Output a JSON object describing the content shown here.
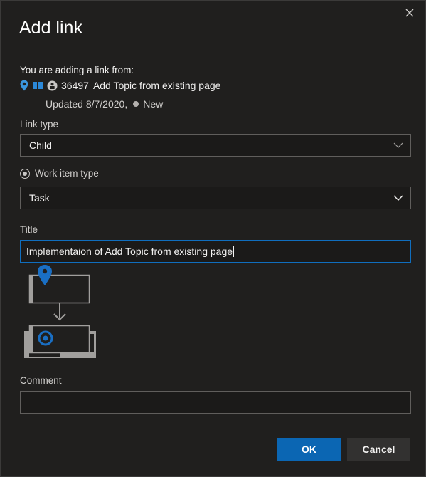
{
  "dialog": {
    "title": "Add link",
    "close_icon": "close-icon"
  },
  "source": {
    "label": "You are adding a link from:",
    "icons": [
      "location-pin-icon",
      "book-icon",
      "lock-person-icon"
    ],
    "id": "36497",
    "link_text": "Add Topic from existing page",
    "updated": "Updated 8/7/2020,",
    "state": "New"
  },
  "link_type": {
    "label": "Link type",
    "value": "Child"
  },
  "work_item_type": {
    "label": "Work item type",
    "value": "Task"
  },
  "title_field": {
    "label": "Title",
    "value": "Implementaion of Add Topic from existing page"
  },
  "comment_field": {
    "label": "Comment",
    "value": ""
  },
  "buttons": {
    "ok": "OK",
    "cancel": "Cancel"
  },
  "colors": {
    "accent": "#0b66b3",
    "background": "#201f1e",
    "focus_border": "#106ebe",
    "diagram_gray": "#a19f9d",
    "diagram_pin": "#1a6fc4"
  }
}
